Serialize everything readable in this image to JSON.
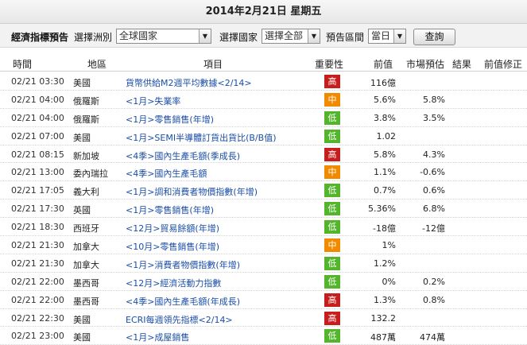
{
  "header": {
    "date_title": "2014年2月21日 星期五"
  },
  "filters": {
    "section_label": "經濟指標預告",
    "continent_label": "選擇洲別",
    "continent_value": "全球國家",
    "country_label": "選擇國家",
    "country_value": "選擇全部",
    "period_label": "預告區間",
    "period_value": "當日",
    "query_button": "查詢"
  },
  "columns": {
    "time": "時間",
    "region": "地區",
    "item": "項目",
    "importance": "重要性",
    "previous": "前值",
    "forecast": "市場預估",
    "result": "結果",
    "revised": "前值修正"
  },
  "importance_colors": {
    "high": "#c71d1d",
    "mid": "#f28a00",
    "low": "#52b52a"
  },
  "rows": [
    {
      "time": "02/21 03:30",
      "region": "美國",
      "item": "貨幣供給M2週平均數據<2/14>",
      "importance": "高",
      "level": "high",
      "previous": "116億",
      "forecast": ""
    },
    {
      "time": "02/21 04:00",
      "region": "俄羅斯",
      "item": "<1月>失業率",
      "importance": "中",
      "level": "mid",
      "previous": "5.6%",
      "forecast": "5.8%"
    },
    {
      "time": "02/21 04:00",
      "region": "俄羅斯",
      "item": "<1月>零售銷售(年增)",
      "importance": "低",
      "level": "low",
      "previous": "3.8%",
      "forecast": "3.5%"
    },
    {
      "time": "02/21 07:00",
      "region": "美國",
      "item": "<1月>SEMI半導體訂貨出貨比(B/B值)",
      "importance": "低",
      "level": "low",
      "previous": "1.02",
      "forecast": ""
    },
    {
      "time": "02/21 08:15",
      "region": "新加坡",
      "item": "<4季>國內生產毛額(季成長)",
      "importance": "高",
      "level": "high",
      "previous": "5.8%",
      "forecast": "4.3%"
    },
    {
      "time": "02/21 13:00",
      "region": "委內瑞拉",
      "item": "<4季>國內生產毛額",
      "importance": "中",
      "level": "mid",
      "previous": "1.1%",
      "forecast": "-0.6%"
    },
    {
      "time": "02/21 17:05",
      "region": "義大利",
      "item": "<1月>調和消費者物價指數(年增)",
      "importance": "低",
      "level": "low",
      "previous": "0.7%",
      "forecast": "0.6%"
    },
    {
      "time": "02/21 17:30",
      "region": "英國",
      "item": "<1月>零售銷售(年增)",
      "importance": "低",
      "level": "low",
      "previous": "5.36%",
      "forecast": "6.8%"
    },
    {
      "time": "02/21 18:30",
      "region": "西班牙",
      "item": "<12月>貿易餘額(年增)",
      "importance": "低",
      "level": "low",
      "previous": "-18億",
      "forecast": "-12億"
    },
    {
      "time": "02/21 21:30",
      "region": "加拿大",
      "item": "<10月>零售銷售(年增)",
      "importance": "中",
      "level": "mid",
      "previous": "1%",
      "forecast": ""
    },
    {
      "time": "02/21 21:30",
      "region": "加拿大",
      "item": "<1月>消費者物價指數(年增)",
      "importance": "低",
      "level": "low",
      "previous": "1.2%",
      "forecast": ""
    },
    {
      "time": "02/21 22:00",
      "region": "墨西哥",
      "item": "<12月>經濟活動力指數",
      "importance": "低",
      "level": "low",
      "previous": "0%",
      "forecast": "0.2%"
    },
    {
      "time": "02/21 22:00",
      "region": "墨西哥",
      "item": "<4季>國內生產毛額(年成長)",
      "importance": "高",
      "level": "high",
      "previous": "1.3%",
      "forecast": "0.8%"
    },
    {
      "time": "02/21 22:30",
      "region": "美國",
      "item": "ECRI每週領先指標<2/14>",
      "importance": "高",
      "level": "high",
      "previous": "132.2",
      "forecast": ""
    },
    {
      "time": "02/21 23:00",
      "region": "美國",
      "item": "<1月>成屋銷售",
      "importance": "低",
      "level": "low",
      "previous": "487萬",
      "forecast": "474萬"
    }
  ]
}
